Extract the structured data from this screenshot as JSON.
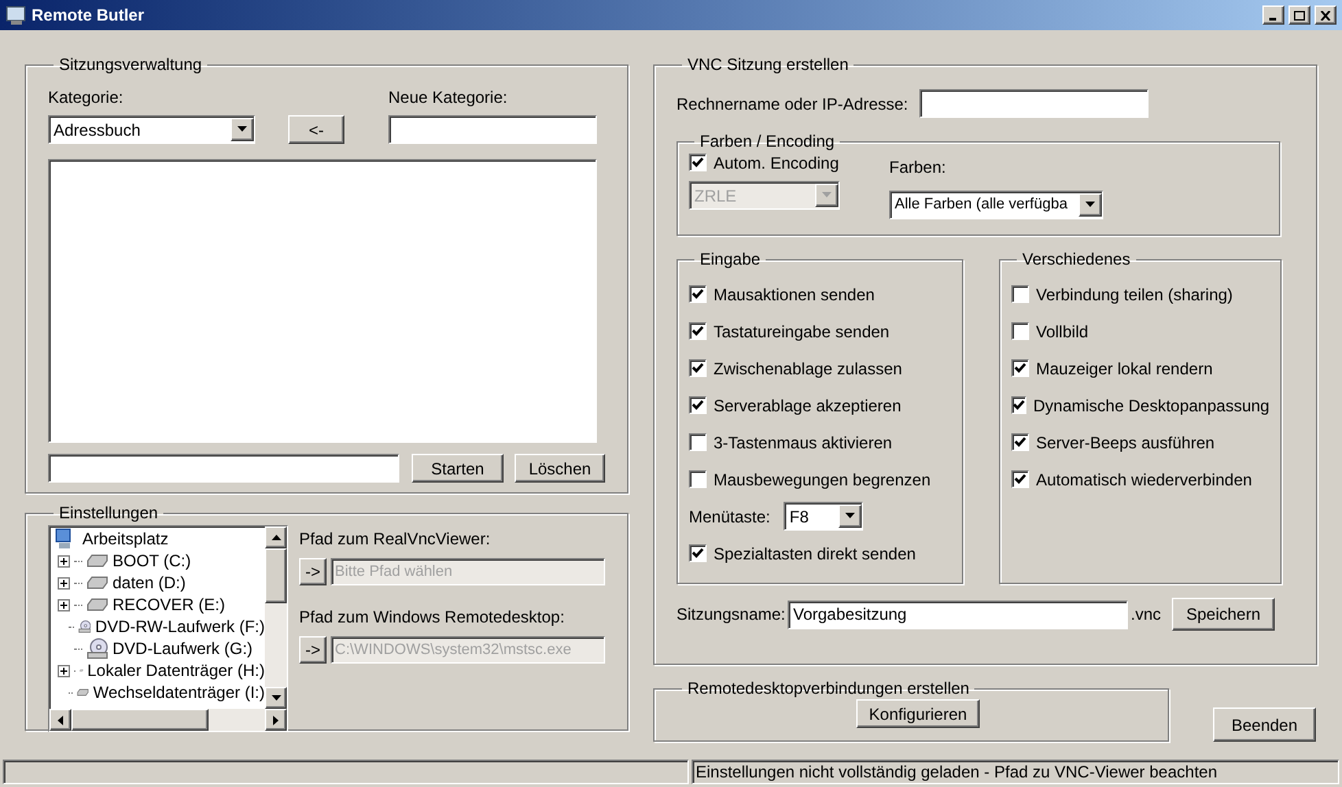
{
  "window": {
    "title": "Remote Butler"
  },
  "session_management": {
    "title": "Sitzungsverwaltung",
    "category_label": "Kategorie:",
    "category_value": "Adressbuch",
    "move_button": "<-",
    "new_category_label": "Neue Kategorie:",
    "start_button": "Starten",
    "delete_button": "Löschen"
  },
  "settings": {
    "title": "Einstellungen",
    "tree": [
      {
        "label": "Arbeitsplatz",
        "kind": "computer",
        "children": [
          {
            "label": "BOOT (C:)",
            "kind": "drive",
            "expandable": true
          },
          {
            "label": "daten (D:)",
            "kind": "drive",
            "expandable": true
          },
          {
            "label": "RECOVER (E:)",
            "kind": "drive",
            "expandable": true
          },
          {
            "label": "DVD-RW-Laufwerk (F:)",
            "kind": "dvd",
            "expandable": false
          },
          {
            "label": "DVD-Laufwerk (G:)",
            "kind": "dvd",
            "expandable": false
          },
          {
            "label": "Lokaler Datenträger (H:)",
            "kind": "drive",
            "expandable": true
          },
          {
            "label": "Wechseldatenträger (I:)",
            "kind": "drive",
            "expandable": false
          }
        ]
      }
    ],
    "vnc_viewer": {
      "label": "Pfad zum RealVncViewer:",
      "button": "->",
      "placeholder": "Bitte Pfad wählen",
      "disabled": true
    },
    "remote_desktop": {
      "label": "Pfad zum Windows Remotedesktop:",
      "button": "->",
      "value": "C:\\WINDOWS\\system32\\mstsc.exe",
      "disabled": true
    }
  },
  "vnc": {
    "title": "VNC Sitzung erstellen",
    "host_label": "Rechnername oder IP-Adresse:",
    "encoding": {
      "title": "Farben / Encoding",
      "auto_encoding": {
        "label": "Autom. Encoding",
        "checked": true
      },
      "encoding_value": "ZRLE",
      "encoding_disabled": true,
      "colors_label": "Farben:",
      "colors_value": "Alle Farben (alle verfügba"
    },
    "input": {
      "title": "Eingabe",
      "items": [
        {
          "kind": "checkbox",
          "label": "Mausaktionen senden",
          "checked": true
        },
        {
          "kind": "checkbox",
          "label": "Tastatureingabe senden",
          "checked": true
        },
        {
          "kind": "checkbox",
          "label": "Zwischenablage zulassen",
          "checked": true
        },
        {
          "kind": "checkbox",
          "label": "Serverablage akzeptieren",
          "checked": true
        },
        {
          "kind": "checkbox",
          "label": "3-Tastenmaus aktivieren",
          "checked": false
        },
        {
          "kind": "checkbox",
          "label": "Mausbewegungen begrenzen",
          "checked": false
        },
        {
          "kind": "select",
          "label": "Menütaste:",
          "value": "F8"
        },
        {
          "kind": "checkbox",
          "label": "Spezialtasten direkt senden",
          "checked": true
        }
      ]
    },
    "misc": {
      "title": "Verschiedenes",
      "items": [
        {
          "kind": "checkbox",
          "label": "Verbindung teilen (sharing)",
          "checked": false
        },
        {
          "kind": "checkbox",
          "label": "Vollbild",
          "checked": false
        },
        {
          "kind": "checkbox",
          "label": "Mauzeiger lokal rendern",
          "checked": true
        },
        {
          "kind": "checkbox",
          "label": "Dynamische Desktopanpassung",
          "checked": true
        },
        {
          "kind": "checkbox",
          "label": "Server-Beeps ausführen",
          "checked": true
        },
        {
          "kind": "checkbox",
          "label": "Automatisch wiederverbinden",
          "checked": true
        }
      ]
    },
    "session_name_label": "Sitzungsname:",
    "session_name_value": "Vorgabesitzung",
    "extension": ".vnc",
    "save_button": "Speichern"
  },
  "remote_desktop": {
    "title": "Remotedesktopverbindungen erstellen",
    "configure_button": "Konfigurieren"
  },
  "quit_button": "Beenden",
  "status_bar": {
    "message": "Einstellungen nicht vollständig geladen - Pfad zu VNC-Viewer beachten"
  }
}
